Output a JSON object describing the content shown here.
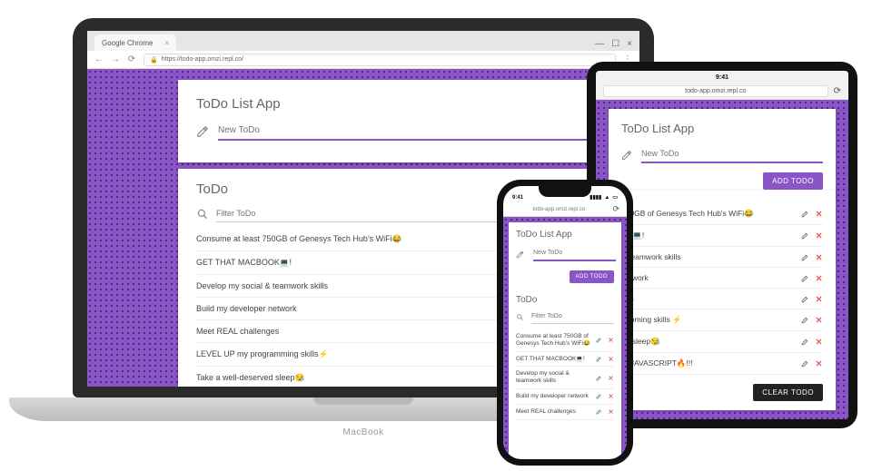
{
  "browser": {
    "tab_title": "Google Chrome",
    "url": "https://todo-app.omzi.repl.co/",
    "safari_url": "todo-app.omzi.repl.co",
    "ios_time": "9:41"
  },
  "app": {
    "title": "ToDo List App",
    "new_placeholder": "New ToDo",
    "add_button": "ADD TODO",
    "section_title": "ToDo",
    "filter_placeholder": "Filter ToDo",
    "clear_button": "CLEAR TODO"
  },
  "todos": [
    {
      "text": "Consume at least 750GB of Genesys Tech Hub's WiFi",
      "emoji": "😂"
    },
    {
      "text": "GET THAT MACBOOK",
      "emoji": "💻",
      "suffix": "!"
    },
    {
      "text": "Develop my social & teamwork skills",
      "emoji": ""
    },
    {
      "text": "Build my developer network",
      "emoji": ""
    },
    {
      "text": "Meet REAL challenges",
      "emoji": ""
    },
    {
      "text": "LEVEL UP my programming skills",
      "emoji": "⚡"
    },
    {
      "text": "Take a well-deserved sleep",
      "emoji": "😪"
    },
    {
      "text": "Read up ELOQUENT JAVASCRIPT",
      "emoji": "🔥",
      "suffix": "!!!"
    }
  ],
  "todos_ipad_trunc": [
    "750GB of Genesys Tech Hub's WiFi😂",
    "OK💻!",
    "& teamwork skills",
    "network",
    "ges",
    "ramming skills ⚡",
    "ed sleep😪",
    "IT JAVASCRIPT🔥!!!"
  ]
}
